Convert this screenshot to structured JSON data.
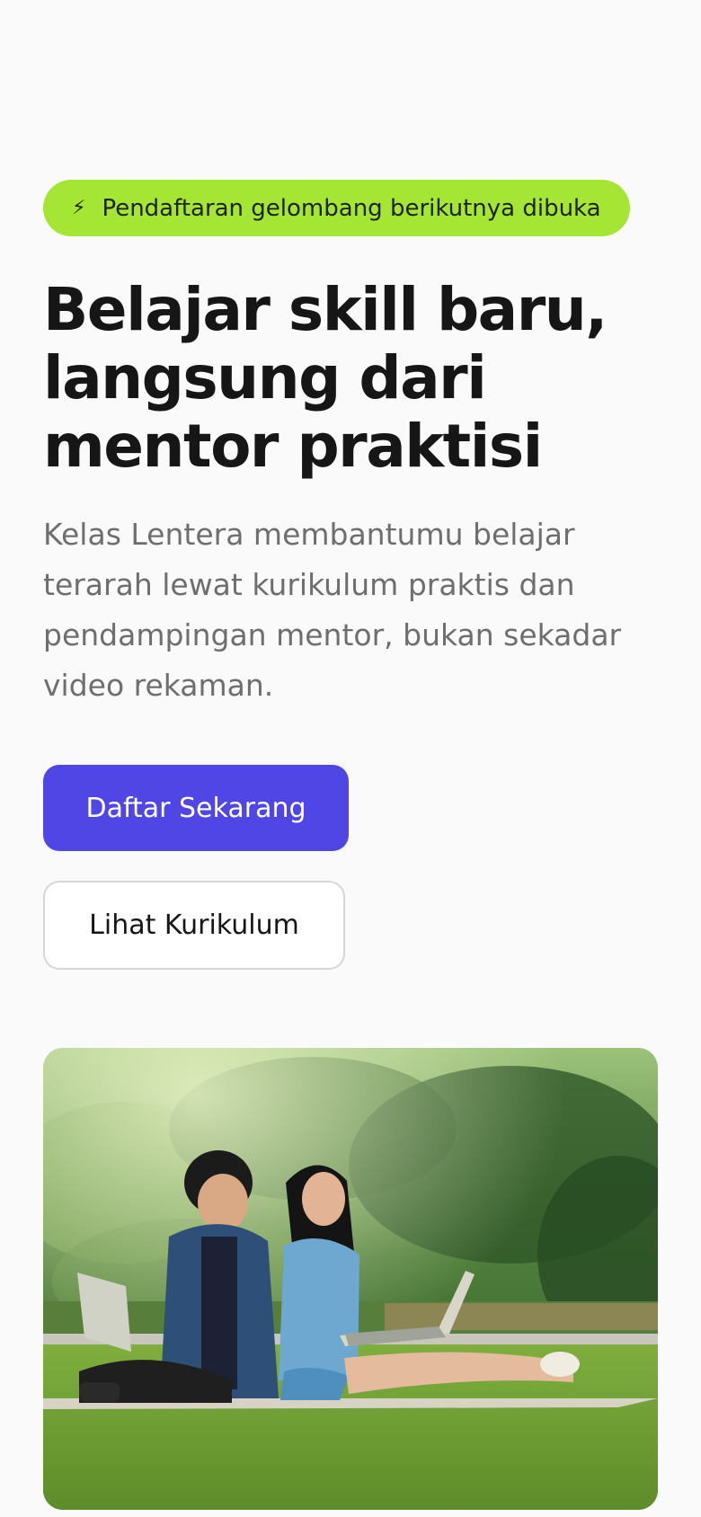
{
  "hero": {
    "badge": {
      "icon": "lightning-icon",
      "text": "Pendaftaran gelombang berikutnya dibuka"
    },
    "headline": "Belajar skill baru, langsung dari mentor praktisi",
    "description": "Kelas Lentera membantumu belajar terarah lewat kurikulum praktis dan pendampingan mentor, bukan sekadar video rekaman.",
    "primary_button": "Daftar Sekarang",
    "secondary_button": "Lihat Kurikulum"
  },
  "colors": {
    "background": "#fafafa",
    "badge": "#a5e534",
    "primary": "#4f46e5",
    "heading": "#161616",
    "body_text": "#6e6e6e"
  }
}
